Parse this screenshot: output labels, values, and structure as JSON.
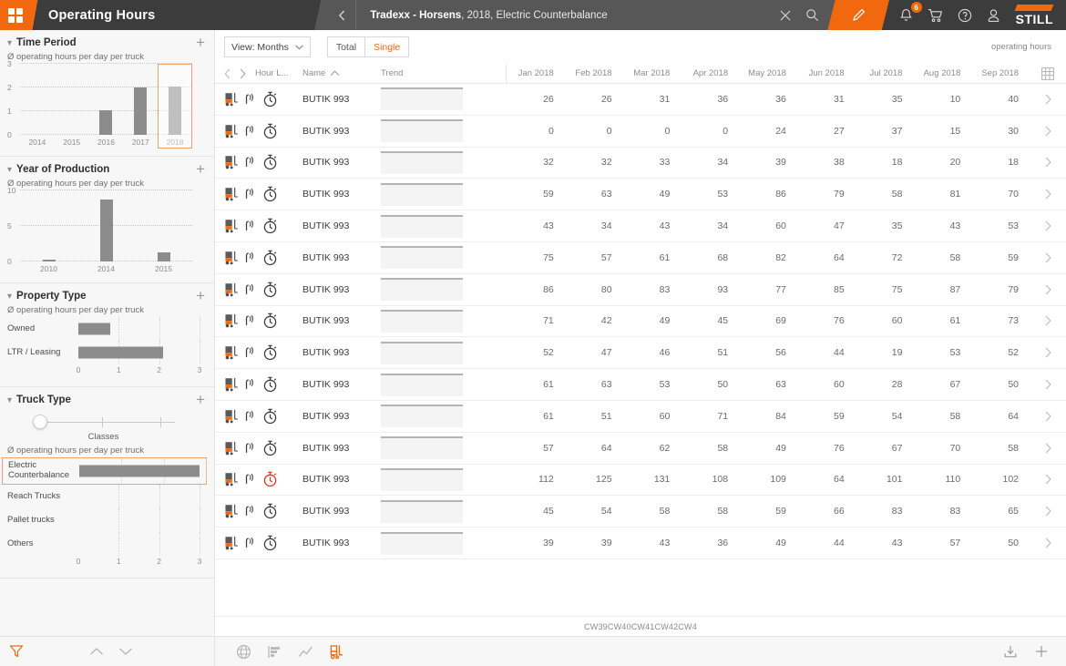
{
  "topbar": {
    "app_title": "Operating Hours",
    "breadcrumb_bold": "Tradexx - Horsens",
    "breadcrumb_rest": ", 2018, Electric Counterbalance",
    "back_icon": "chevron-left-icon",
    "close_icon": "close-icon",
    "search_icon": "search-icon",
    "edit_icon": "pencil-icon",
    "bell_icon": "bell-icon",
    "bell_badge": "6",
    "cart_icon": "cart-icon",
    "help_icon": "help-icon",
    "user_icon": "user-icon",
    "brand": "STILL",
    "accent_color": "#f2680f"
  },
  "sidebar": {
    "panels": [
      {
        "title": "Time Period",
        "subtitle": "Ø operating hours per day per truck",
        "add_label": "+",
        "chart": {
          "type": "bar",
          "orientation": "vertical",
          "categories": [
            "2014",
            "2015",
            "2016",
            "2017",
            "2018"
          ],
          "values": [
            0,
            0,
            1.05,
            2.0,
            2.02
          ],
          "ylim": [
            0,
            3
          ],
          "yticks": [
            "0",
            "1",
            "2",
            "3"
          ],
          "selected_index": 4
        }
      },
      {
        "title": "Year of Production",
        "subtitle": "Ø operating hours per day per truck",
        "add_label": "+",
        "chart": {
          "type": "bar",
          "orientation": "vertical",
          "categories": [
            "2010",
            "2014",
            "2015"
          ],
          "values": [
            0.3,
            8.7,
            1.3
          ],
          "ylim": [
            0,
            10
          ],
          "yticks": [
            "0",
            "5",
            "10"
          ],
          "selected_index": -1
        }
      },
      {
        "title": "Property Type",
        "subtitle": "Ø operating hours per day per truck",
        "add_label": "+",
        "chart": {
          "type": "bar",
          "orientation": "horizontal",
          "categories": [
            "Owned",
            "LTR / Leasing"
          ],
          "values": [
            0.8,
            2.1
          ],
          "xlim": [
            0,
            3
          ],
          "xticks": [
            "0",
            "1",
            "2",
            "3"
          ],
          "selected_index": -1
        }
      },
      {
        "title": "Truck Type",
        "subtitle": "Ø operating hours per day per truck",
        "add_label": "+",
        "slider_label": "Classes",
        "chart": {
          "type": "bar",
          "orientation": "horizontal",
          "categories": [
            "Electric Counterbalance",
            "Reach Trucks",
            "Pallet trucks",
            "Others"
          ],
          "values": [
            2.85,
            0,
            0,
            0
          ],
          "xlim": [
            0,
            3
          ],
          "xticks": [
            "0",
            "1",
            "2",
            "3"
          ],
          "selected_index": 0
        }
      }
    ],
    "footer": {
      "filter_icon": "filter-funnel-icon",
      "up_icon": "chevron-up-icon",
      "down_icon": "chevron-down-icon"
    }
  },
  "main": {
    "toolbar": {
      "view_label": "View: Months",
      "view_caret": "chevron-down-icon",
      "total_label": "Total",
      "single_label": "Single",
      "unit_label": "operating hours"
    },
    "table": {
      "nav_prev": "chevron-left-icon",
      "nav_next": "chevron-right-icon",
      "col_hour": "Hour L...",
      "col_name": "Name",
      "sort_icon": "chevron-up-icon",
      "col_trend": "Trend",
      "grid_icon": "grid-table-icon",
      "months": [
        "Jan 2018",
        "Feb 2018",
        "Mar 2018",
        "Apr 2018",
        "May 2018",
        "Jun 2018",
        "Jul 2018",
        "Aug 2018",
        "Sep 2018"
      ],
      "rows": [
        {
          "name": "BUTIK 993",
          "watch": "normal",
          "values": [
            26,
            26,
            31,
            36,
            36,
            31,
            35,
            10,
            40
          ]
        },
        {
          "name": "BUTIK 993",
          "watch": "normal",
          "values": [
            0,
            0,
            0,
            0,
            24,
            27,
            37,
            15,
            30
          ]
        },
        {
          "name": "BUTIK 993",
          "watch": "normal",
          "values": [
            32,
            32,
            33,
            34,
            39,
            38,
            18,
            20,
            18
          ]
        },
        {
          "name": "BUTIK 993",
          "watch": "normal",
          "values": [
            59,
            63,
            49,
            53,
            86,
            79,
            58,
            81,
            70
          ]
        },
        {
          "name": "BUTIK 993",
          "watch": "normal",
          "values": [
            43,
            34,
            43,
            34,
            60,
            47,
            35,
            43,
            53
          ]
        },
        {
          "name": "BUTIK 993",
          "watch": "normal",
          "values": [
            75,
            57,
            61,
            68,
            82,
            64,
            72,
            58,
            59
          ]
        },
        {
          "name": "BUTIK 993",
          "watch": "normal",
          "values": [
            86,
            80,
            83,
            93,
            77,
            85,
            75,
            87,
            79
          ]
        },
        {
          "name": "BUTIK 993",
          "watch": "normal",
          "values": [
            71,
            42,
            49,
            45,
            69,
            76,
            60,
            61,
            73
          ]
        },
        {
          "name": "BUTIK 993",
          "watch": "normal",
          "values": [
            52,
            47,
            46,
            51,
            56,
            44,
            19,
            53,
            52
          ]
        },
        {
          "name": "BUTIK 993",
          "watch": "normal",
          "values": [
            61,
            63,
            53,
            50,
            63,
            60,
            28,
            67,
            50
          ]
        },
        {
          "name": "BUTIK 993",
          "watch": "normal",
          "values": [
            61,
            51,
            60,
            71,
            84,
            59,
            54,
            58,
            64
          ]
        },
        {
          "name": "BUTIK 993",
          "watch": "normal",
          "values": [
            57,
            64,
            62,
            58,
            49,
            76,
            67,
            70,
            58
          ]
        },
        {
          "name": "BUTIK 993",
          "watch": "alert",
          "values": [
            112,
            125,
            131,
            108,
            109,
            64,
            101,
            110,
            102
          ]
        },
        {
          "name": "BUTIK 993",
          "watch": "normal",
          "values": [
            45,
            54,
            58,
            58,
            59,
            66,
            83,
            83,
            65
          ]
        },
        {
          "name": "BUTIK 993",
          "watch": "normal",
          "values": [
            39,
            39,
            43,
            36,
            49,
            44,
            43,
            57,
            50
          ]
        }
      ],
      "row_arrow": "chevron-right-icon"
    },
    "footer_text": "CW39CW40CW41CW42CW4",
    "bottom_icons": [
      {
        "name": "globe-icon",
        "active": false
      },
      {
        "name": "bar-chart-icon",
        "active": false
      },
      {
        "name": "line-chart-icon",
        "active": false
      },
      {
        "name": "forklift-icon",
        "active": true
      }
    ],
    "bottom_right_icons": [
      {
        "name": "export-download-icon"
      },
      {
        "name": "plus-icon"
      }
    ]
  }
}
